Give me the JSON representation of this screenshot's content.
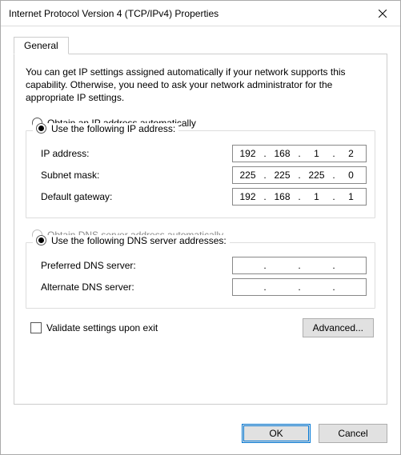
{
  "window": {
    "title": "Internet Protocol Version 4 (TCP/IPv4) Properties",
    "close_icon": "close-icon"
  },
  "tabs": {
    "general": "General"
  },
  "intro": "You can get IP settings assigned automatically if your network supports this capability. Otherwise, you need to ask your network administrator for the appropriate IP settings.",
  "ip": {
    "radio_auto_label": "Obtain an IP address automatically",
    "radio_auto_selected": false,
    "radio_manual_label": "Use the following IP address:",
    "radio_manual_selected": true,
    "fields": {
      "ip_label": "IP address:",
      "ip": {
        "o1": "192",
        "o2": "168",
        "o3": "1",
        "o4": "2"
      },
      "subnet_label": "Subnet mask:",
      "subnet": {
        "o1": "225",
        "o2": "225",
        "o3": "225",
        "o4": "0"
      },
      "gateway_label": "Default gateway:",
      "gateway": {
        "o1": "192",
        "o2": "168",
        "o3": "1",
        "o4": "1"
      }
    }
  },
  "dns": {
    "radio_auto_label": "Obtain DNS server address automatically",
    "radio_auto_selected": false,
    "radio_auto_enabled": false,
    "radio_manual_label": "Use the following DNS server addresses:",
    "radio_manual_selected": true,
    "fields": {
      "preferred_label": "Preferred DNS server:",
      "preferred": {
        "o1": "",
        "o2": "",
        "o3": "",
        "o4": ""
      },
      "alternate_label": "Alternate DNS server:",
      "alternate": {
        "o1": "",
        "o2": "",
        "o3": "",
        "o4": ""
      }
    }
  },
  "validate": {
    "label": "Validate settings upon exit",
    "checked": false
  },
  "buttons": {
    "advanced": "Advanced...",
    "ok": "OK",
    "cancel": "Cancel"
  }
}
